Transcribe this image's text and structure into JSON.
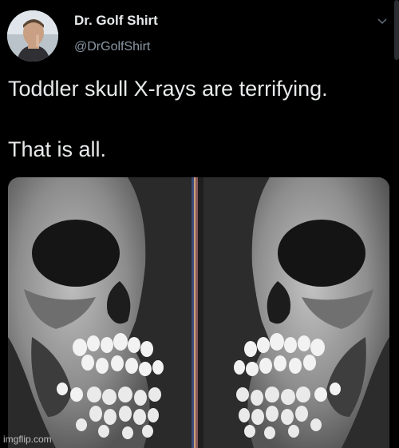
{
  "tweet": {
    "author_name": "Dr. Golf Shirt",
    "author_handle": "@DrGolfShirt",
    "text_line_1": "Toddler skull X-rays are terrifying.",
    "text_line_2": "That is all.",
    "menu_icon": "chevron-down-icon",
    "media_description_icon": "xray-image"
  },
  "watermark": {
    "text": "imgflip.com"
  },
  "colors": {
    "background": "#000000",
    "text_primary": "#e7e9ea",
    "text_secondary": "#8b98a5"
  }
}
